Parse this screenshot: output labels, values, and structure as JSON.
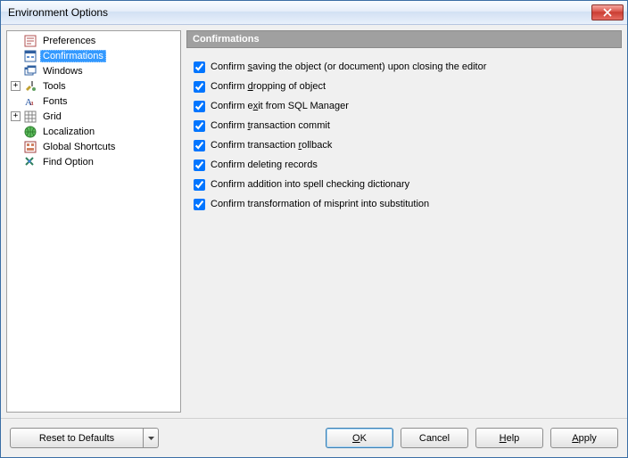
{
  "window": {
    "title": "Environment Options"
  },
  "tree": {
    "items": [
      {
        "label": "Preferences",
        "expandable": false,
        "icon": "pref"
      },
      {
        "label": "Confirmations",
        "expandable": false,
        "icon": "confirm",
        "selected": true
      },
      {
        "label": "Windows",
        "expandable": false,
        "icon": "windows"
      },
      {
        "label": "Tools",
        "expandable": true,
        "icon": "tools"
      },
      {
        "label": "Fonts",
        "expandable": false,
        "icon": "fonts"
      },
      {
        "label": "Grid",
        "expandable": true,
        "icon": "grid"
      },
      {
        "label": "Localization",
        "expandable": false,
        "icon": "local"
      },
      {
        "label": "Global Shortcuts",
        "expandable": false,
        "icon": "shortcut"
      },
      {
        "label": "Find Option",
        "expandable": false,
        "icon": "find"
      }
    ]
  },
  "section": {
    "title": "Confirmations"
  },
  "checks": [
    {
      "pre": "Confirm ",
      "u": "s",
      "post": "aving the object (or document) upon closing the editor",
      "checked": true
    },
    {
      "pre": "Confirm ",
      "u": "d",
      "post": "ropping of object",
      "checked": true
    },
    {
      "pre": "Confirm e",
      "u": "x",
      "post": "it from SQL Manager",
      "checked": true
    },
    {
      "pre": "Confirm ",
      "u": "t",
      "post": "ransaction commit",
      "checked": true
    },
    {
      "pre": "Confirm transaction ",
      "u": "r",
      "post": "ollback",
      "checked": true
    },
    {
      "pre": "Confirm deleting records",
      "u": "",
      "post": "",
      "checked": true
    },
    {
      "pre": "Confirm addition into spell checking dictionary",
      "u": "",
      "post": "",
      "checked": true
    },
    {
      "pre": "Confirm transformation of misprint into substitution",
      "u": "",
      "post": "",
      "checked": true
    }
  ],
  "buttons": {
    "reset": "Reset to Defaults",
    "ok_u": "O",
    "ok_post": "K",
    "cancel": "Cancel",
    "help_u": "H",
    "help_post": "elp",
    "apply_u": "A",
    "apply_post": "pply"
  }
}
